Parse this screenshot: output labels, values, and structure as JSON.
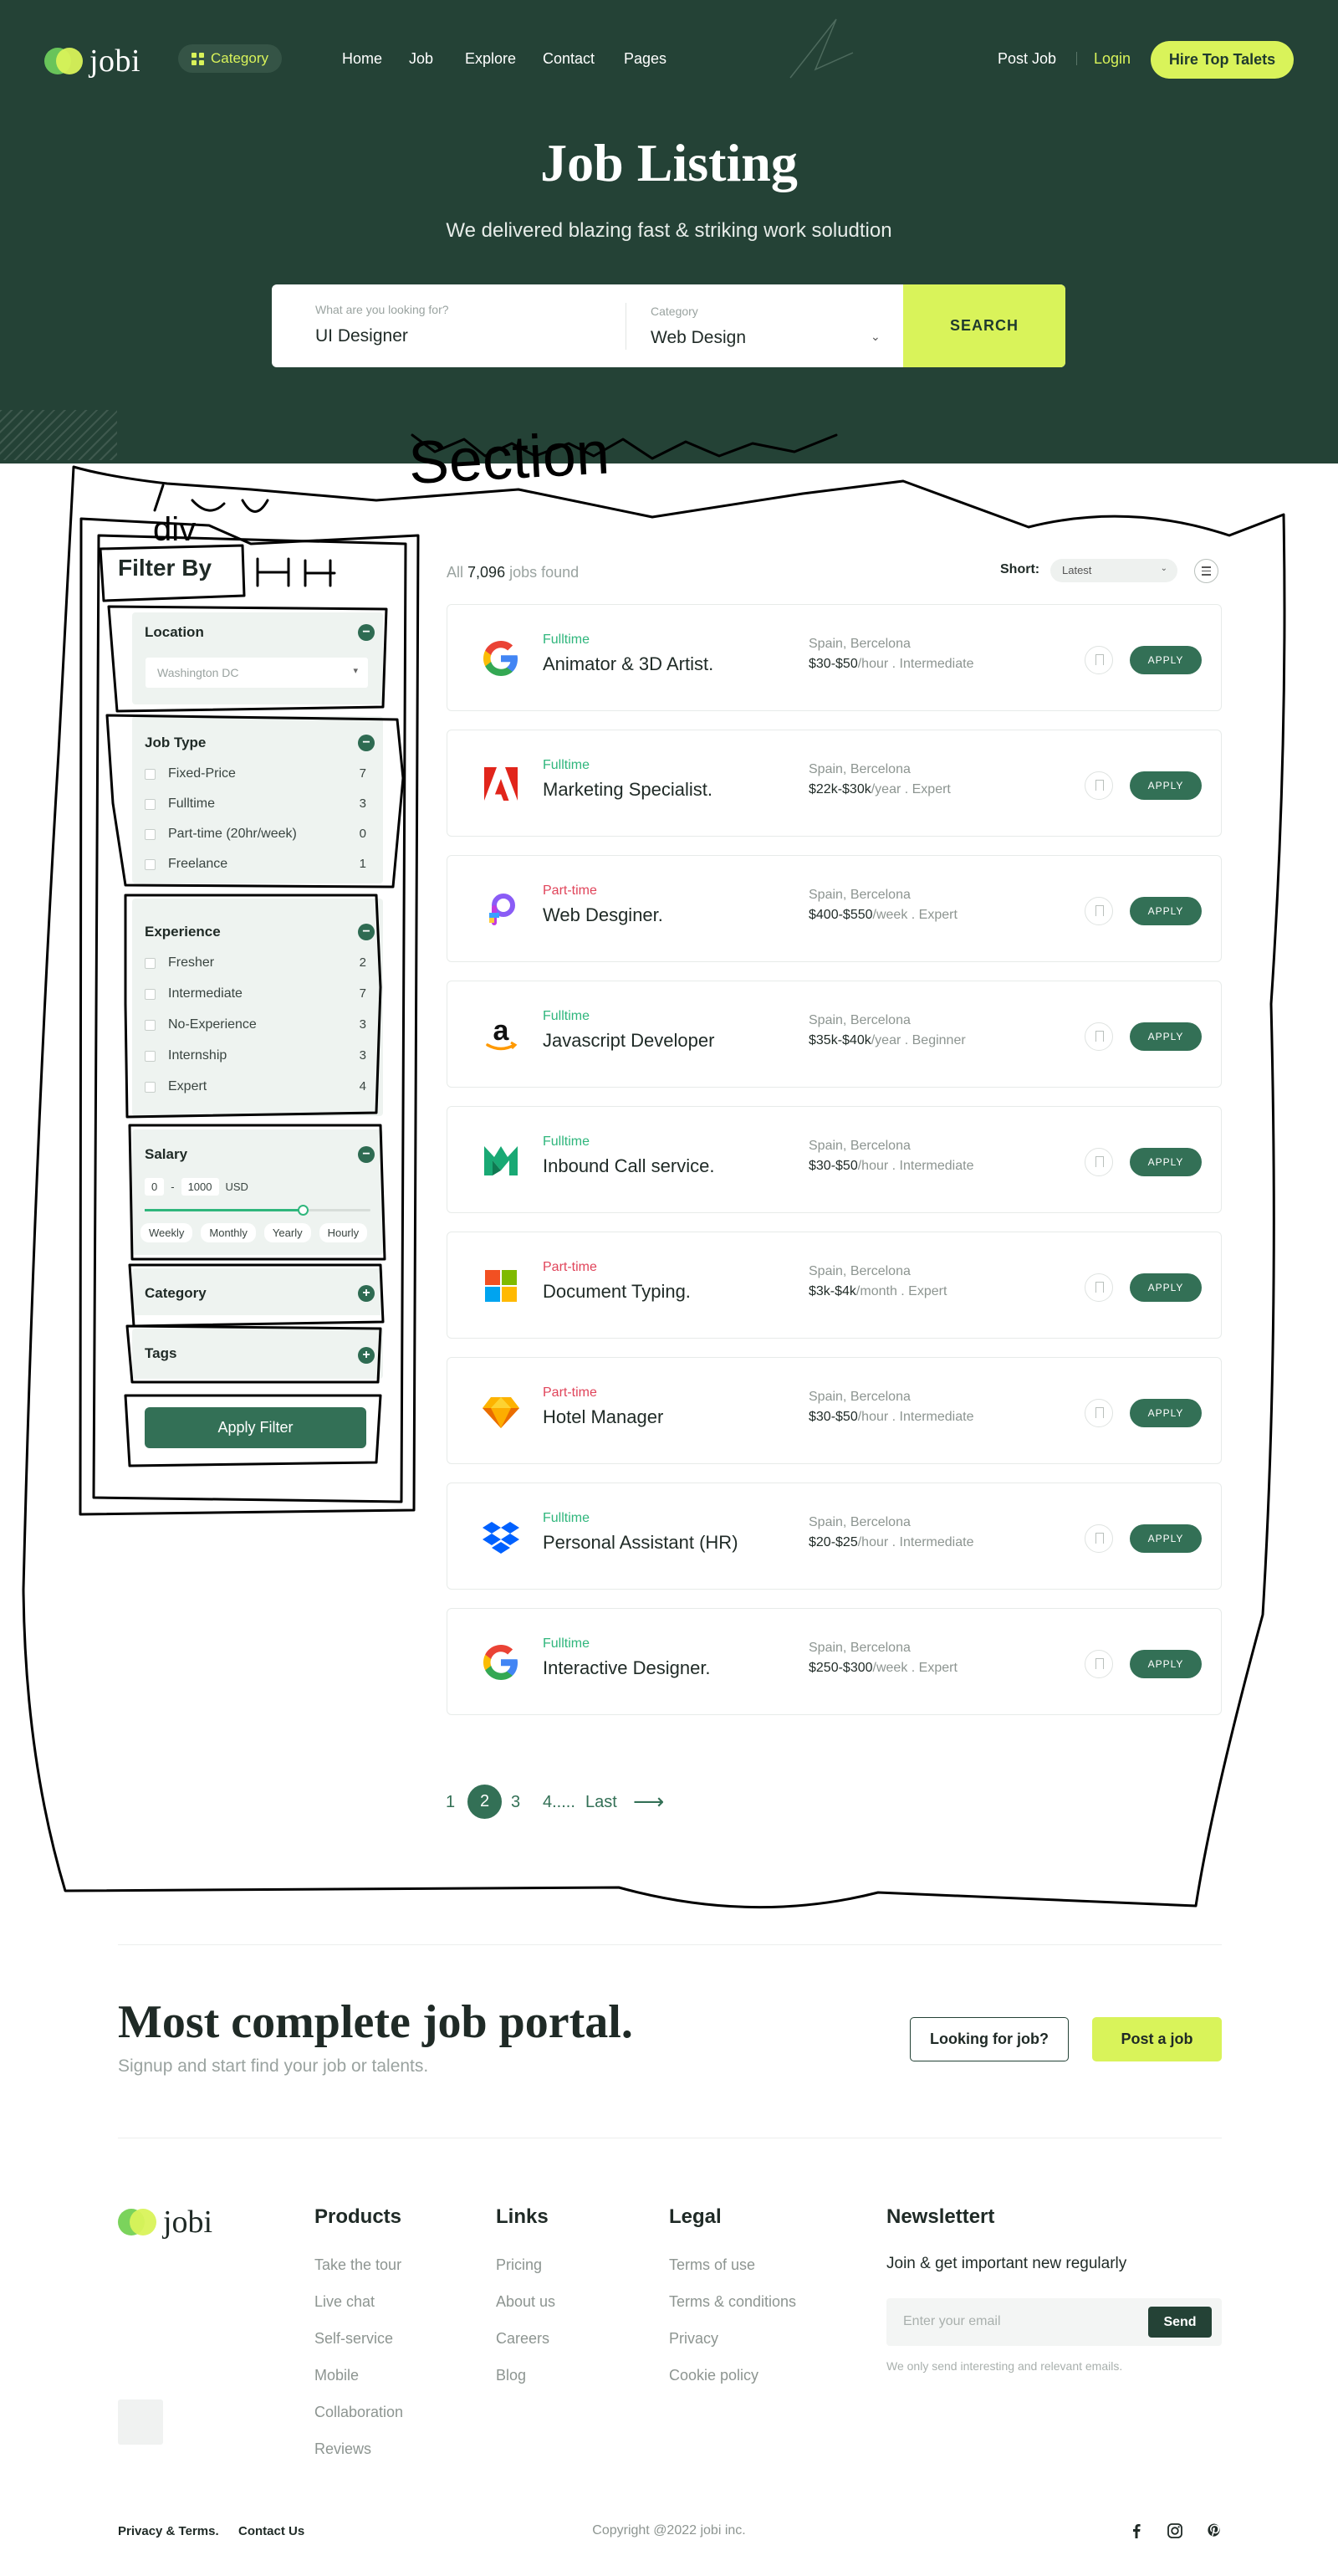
{
  "brand": {
    "name": "jobi",
    "colors": {
      "primary": "#244236",
      "accent": "#d9f35a",
      "button": "#337056",
      "fulltime": "#2fb67c",
      "parttime": "#e0445a"
    }
  },
  "nav": {
    "category_label": "Category",
    "items": [
      "Home",
      "Job",
      "Explore",
      "Contact",
      "Pages"
    ],
    "post_job": "Post Job",
    "login": "Login",
    "hire": "Hire Top Talets"
  },
  "hero": {
    "title": "Job Listing",
    "subtitle": "We delivered blazing fast & striking work soludtion"
  },
  "search": {
    "query_label": "What are you looking for?",
    "query_value": "UI Designer",
    "category_label": "Category",
    "category_value": "Web Design",
    "button": "SEARCH"
  },
  "annotations": {
    "section": "Section",
    "div": "div",
    "h4": "H4"
  },
  "filter": {
    "title": "Filter By",
    "location": {
      "title": "Location",
      "toggle": "−",
      "value": "Washington DC"
    },
    "job_type": {
      "title": "Job Type",
      "toggle": "−",
      "options": [
        {
          "label": "Fixed-Price",
          "count": "7"
        },
        {
          "label": "Fulltime",
          "count": "3"
        },
        {
          "label": "Part-time (20hr/week)",
          "count": "0"
        },
        {
          "label": "Freelance",
          "count": "1"
        }
      ]
    },
    "experience": {
      "title": "Experience",
      "toggle": "−",
      "options": [
        {
          "label": "Fresher",
          "count": "2"
        },
        {
          "label": "Intermediate",
          "count": "7"
        },
        {
          "label": "No-Experience",
          "count": "3"
        },
        {
          "label": "Internship",
          "count": "3"
        },
        {
          "label": "Expert",
          "count": "4"
        }
      ]
    },
    "salary": {
      "title": "Salary",
      "toggle": "−",
      "min": "0",
      "sep": "-",
      "max": "1000",
      "currency": "USD",
      "range_fraction": 0.7,
      "periods": [
        "Weekly",
        "Monthly",
        "Yearly",
        "Hourly"
      ]
    },
    "category": {
      "title": "Category",
      "toggle": "+"
    },
    "tags": {
      "title": "Tags",
      "toggle": "+"
    },
    "apply": "Apply Filter"
  },
  "listing": {
    "found_prefix": "All",
    "found_count": "7,096",
    "found_suffix": "jobs found",
    "sort_label": "Short:",
    "sort_value": "Latest",
    "apply_label": "APPLY",
    "jobs": [
      {
        "logo": "google-icon",
        "type": "Fulltime",
        "type_color": "#2fb67c",
        "title": "Animator & 3D Artist.",
        "location": "Spain, Bercelona",
        "pay": "$30-$50",
        "pay_suffix": "/hour . Intermediate"
      },
      {
        "logo": "adobe-icon",
        "type": "Fulltime",
        "type_color": "#2fb67c",
        "title": "Marketing Specialist.",
        "location": "Spain, Bercelona",
        "pay": "$22k-$30k",
        "pay_suffix": "/year . Expert"
      },
      {
        "logo": "picsart-icon",
        "type": "Part-time",
        "type_color": "#e0445a",
        "title": "Web Desginer.",
        "location": "Spain, Bercelona",
        "pay": "$400-$550",
        "pay_suffix": "/week . Expert"
      },
      {
        "logo": "amazon-icon",
        "type": "Fulltime",
        "type_color": "#2fb67c",
        "title": "Javascript Developer",
        "location": "Spain, Bercelona",
        "pay": "$35k-$40k",
        "pay_suffix": "/year . Beginner"
      },
      {
        "logo": "m-brand-icon",
        "type": "Fulltime",
        "type_color": "#2fb67c",
        "title": "Inbound Call service.",
        "location": "Spain, Bercelona",
        "pay": "$30-$50",
        "pay_suffix": "/hour . Intermediate"
      },
      {
        "logo": "microsoft-icon",
        "type": "Part-time",
        "type_color": "#e0445a",
        "title": "Document Typing.",
        "location": "Spain, Bercelona",
        "pay": "$3k-$4k",
        "pay_suffix": "/month . Expert"
      },
      {
        "logo": "sketch-icon",
        "type": "Part-time",
        "type_color": "#e0445a",
        "title": "Hotel Manager",
        "location": "Spain, Bercelona",
        "pay": "$30-$50",
        "pay_suffix": "/hour . Intermediate"
      },
      {
        "logo": "dropbox-icon",
        "type": "Fulltime",
        "type_color": "#2fb67c",
        "title": "Personal Assistant (HR)",
        "location": "Spain, Bercelona",
        "pay": "$20-$25",
        "pay_suffix": "/hour . Intermediate"
      },
      {
        "logo": "google-icon",
        "type": "Fulltime",
        "type_color": "#2fb67c",
        "title": "Interactive Designer.",
        "location": "Spain, Bercelona",
        "pay": "$250-$300",
        "pay_suffix": "/week . Expert"
      }
    ]
  },
  "pagination": {
    "pages": [
      "1",
      "2",
      "3",
      "4....."
    ],
    "current": "2",
    "last": "Last",
    "arrow": "⟶"
  },
  "cta": {
    "title": "Most complete job portal.",
    "subtitle": "Signup and start find your job or talents.",
    "looking": "Looking for job?",
    "post": "Post a job"
  },
  "footer": {
    "columns": [
      {
        "title": "Products",
        "links": [
          "Take the tour",
          "Live chat",
          "Self-service",
          "Mobile",
          "Collaboration",
          "Reviews"
        ]
      },
      {
        "title": "Links",
        "links": [
          "Pricing",
          "About us",
          "Careers",
          "Blog"
        ]
      },
      {
        "title": "Legal",
        "links": [
          "Terms of use",
          "Terms & conditions",
          "Privacy",
          "Cookie policy"
        ]
      }
    ],
    "newsletter": {
      "title": "Newslettert",
      "text": "Join & get important new regularly",
      "placeholder": "Enter your email",
      "send": "Send",
      "note": "We only send interesting and relevant emails."
    },
    "bottom": {
      "privacy": "Privacy & Terms.",
      "contact": "Contact Us",
      "copyright": "Copyright @2022 jobi inc."
    },
    "social": [
      "facebook-icon",
      "instagram-icon",
      "pinterest-icon"
    ]
  }
}
